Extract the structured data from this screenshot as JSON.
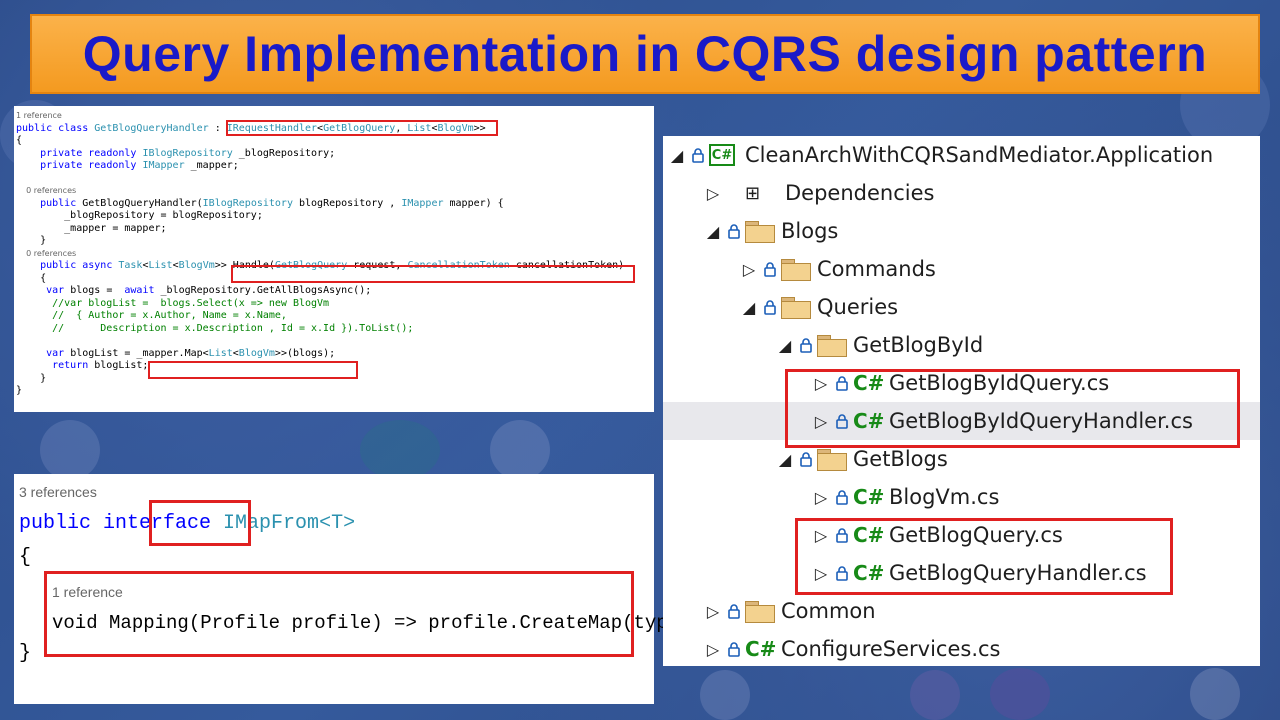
{
  "title": "Query Implementation in CQRS design pattern",
  "code_top": {
    "lines": [
      {
        "t": "ref",
        "text": "1 reference"
      },
      {
        "t": "code",
        "html": "<span class='kw'>public class</span> <span class='ty'>GetBlogQueryHandler</span> : <span class='ty'>IRequestHandler</span>&lt;<span class='ty'>GetBlogQuery</span>, <span class='ty'>List</span>&lt;<span class='ty'>BlogVm</span>&gt;&gt;"
      },
      {
        "t": "code",
        "html": "{"
      },
      {
        "t": "code",
        "html": "    <span class='kw'>private readonly</span> <span class='ty'>IBlogRepository</span> _blogRepository;"
      },
      {
        "t": "code",
        "html": "    <span class='kw'>private readonly</span> <span class='ty'>IMapper</span> _mapper;"
      },
      {
        "t": "code",
        "html": ""
      },
      {
        "t": "ref",
        "text": "    0 references"
      },
      {
        "t": "code",
        "html": "    <span class='kw'>public</span> GetBlogQueryHandler(<span class='ty'>IBlogRepository</span> blogRepository , <span class='ty'>IMapper</span> mapper) {"
      },
      {
        "t": "code",
        "html": "        _blogRepository = blogRepository;"
      },
      {
        "t": "code",
        "html": "        _mapper = mapper;"
      },
      {
        "t": "code",
        "html": "    }"
      },
      {
        "t": "ref",
        "text": "    0 references"
      },
      {
        "t": "code",
        "html": "    <span class='kw'>public async</span> <span class='ty'>Task</span>&lt;<span class='ty'>List</span>&lt;<span class='ty'>BlogVm</span>&gt;&gt; Handle(<span class='ty'>GetBlogQuery</span> request, <span class='ty'>CancellationToken</span> cancellationToken)"
      },
      {
        "t": "code",
        "html": "    {"
      },
      {
        "t": "code",
        "html": "     <span class='kw'>var</span> blogs =  <span class='kw'>await</span> _blogRepository.GetAllBlogsAsync();"
      },
      {
        "t": "code",
        "html": "      <span class='cm'>//var blogList =  blogs.Select(x =&gt; new BlogVm</span>"
      },
      {
        "t": "code",
        "html": "      <span class='cm'>//  { Author = x.Author, Name = x.Name,</span>"
      },
      {
        "t": "code",
        "html": "      <span class='cm'>//      Description = x.Description , Id = x.Id }).ToList();</span>"
      },
      {
        "t": "code",
        "html": ""
      },
      {
        "t": "code",
        "html": "     <span class='kw'>var</span> blogList = _mapper.Map&lt;<span class='ty'>List</span>&lt;<span class='ty'>BlogVm</span>&gt;&gt;(blogs);"
      },
      {
        "t": "code",
        "html": "      <span class='kw'>return</span> blogList;"
      },
      {
        "t": "code",
        "html": "    }"
      },
      {
        "t": "code",
        "html": "}"
      }
    ]
  },
  "code_bottom": {
    "refs_1": "3 references",
    "line_interface_kw": "public interface",
    "line_interface_name": "IMapFrom<T>",
    "brace_open": "{",
    "refs_2": "1 reference",
    "mapping_line": "void Mapping(Profile profile) => profile.CreateMap(typeof(T), GetType());",
    "brace_close": "}"
  },
  "solution_explorer": {
    "items": [
      {
        "label": "CleanArchWithCQRSandMediator.Application",
        "kind": "project",
        "level": 0,
        "expanded": true
      },
      {
        "label": "Dependencies",
        "kind": "deps",
        "level": 1,
        "expanded": false
      },
      {
        "label": "Blogs",
        "kind": "folder",
        "level": 1,
        "expanded": true
      },
      {
        "label": "Commands",
        "kind": "folder",
        "level": 2,
        "expanded": false
      },
      {
        "label": "Queries",
        "kind": "folder",
        "level": 2,
        "expanded": true
      },
      {
        "label": "GetBlogById",
        "kind": "folder",
        "level": 3,
        "expanded": true
      },
      {
        "label": "GetBlogByIdQuery.cs",
        "kind": "cs",
        "level": 4,
        "expanded": false
      },
      {
        "label": "GetBlogByIdQueryHandler.cs",
        "kind": "cs",
        "level": 4,
        "expanded": false,
        "selected": true
      },
      {
        "label": "GetBlogs",
        "kind": "folder",
        "level": 3,
        "expanded": true
      },
      {
        "label": "BlogVm.cs",
        "kind": "cs",
        "level": 4,
        "expanded": false
      },
      {
        "label": "GetBlogQuery.cs",
        "kind": "cs",
        "level": 4,
        "expanded": false
      },
      {
        "label": "GetBlogQueryHandler.cs",
        "kind": "cs",
        "level": 4,
        "expanded": false
      },
      {
        "label": "Common",
        "kind": "folder",
        "level": 1,
        "expanded": false
      },
      {
        "label": "ConfigureServices.cs",
        "kind": "cs",
        "level": 1,
        "expanded": false
      }
    ]
  },
  "colors": {
    "title_text": "#1a1ac8",
    "title_bg": "#f7a52e",
    "highlight": "#e02020",
    "csharp": "#178a17"
  }
}
